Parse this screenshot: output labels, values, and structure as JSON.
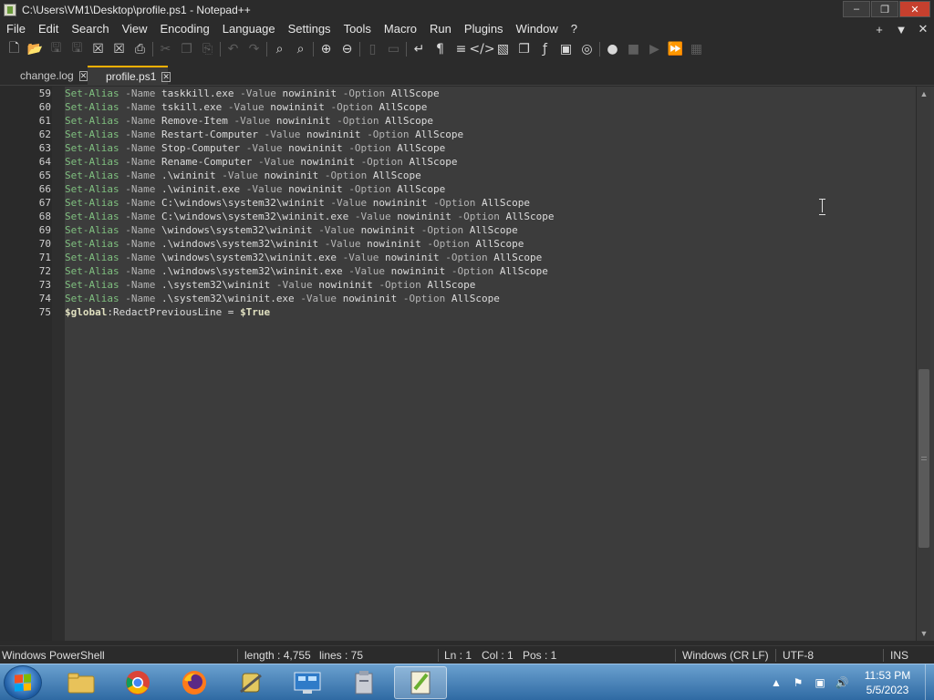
{
  "window": {
    "title": "C:\\Users\\VM1\\Desktop\\profile.ps1 - Notepad++",
    "min": "–",
    "restore": "❐",
    "close": "✕"
  },
  "menu": {
    "items": [
      "File",
      "Edit",
      "Search",
      "View",
      "Encoding",
      "Language",
      "Settings",
      "Tools",
      "Macro",
      "Run",
      "Plugins",
      "Window",
      "?"
    ],
    "right": [
      "+",
      "▼",
      "✕"
    ]
  },
  "tabs": [
    {
      "label": "change.log",
      "active": false
    },
    {
      "label": "profile.ps1",
      "active": true
    }
  ],
  "editor": {
    "lines": [
      {
        "n": "59",
        "name": "taskkill.exe"
      },
      {
        "n": "60",
        "name": "tskill.exe"
      },
      {
        "n": "61",
        "name": "Remove-Item"
      },
      {
        "n": "62",
        "name": "Restart-Computer"
      },
      {
        "n": "63",
        "name": "Stop-Computer"
      },
      {
        "n": "64",
        "name": "Rename-Computer"
      },
      {
        "n": "65",
        "name": ".\\wininit"
      },
      {
        "n": "66",
        "name": ".\\wininit.exe"
      },
      {
        "n": "67",
        "name": "C:\\windows\\system32\\wininit"
      },
      {
        "n": "68",
        "name": "C:\\windows\\system32\\wininit.exe"
      },
      {
        "n": "69",
        "name": "\\windows\\system32\\wininit"
      },
      {
        "n": "70",
        "name": ".\\windows\\system32\\wininit"
      },
      {
        "n": "71",
        "name": "\\windows\\system32\\wininit.exe"
      },
      {
        "n": "72",
        "name": ".\\windows\\system32\\wininit.exe"
      },
      {
        "n": "73",
        "name": ".\\system32\\wininit"
      },
      {
        "n": "74",
        "name": ".\\system32\\wininit.exe"
      }
    ],
    "cmd": "Set-Alias",
    "p_name": "-Name",
    "p_value": "-Value",
    "value": "nowininit",
    "p_option": "-Option",
    "option": "AllScope",
    "last_line": {
      "n": "75",
      "var": "$global",
      "rest": ":RedactPreviousLine = ",
      "val": "$True"
    }
  },
  "status": {
    "language": "Windows PowerShell",
    "length": "length : 4,755",
    "lines": "lines : 75",
    "ln": "Ln : 1",
    "col": "Col : 1",
    "pos": "Pos : 1",
    "eol": "Windows (CR LF)",
    "encoding": "UTF-8",
    "mode": "INS"
  },
  "taskbar": {
    "time": "11:53 PM",
    "date": "5/5/2023"
  },
  "colors": {
    "accent_tab": "#ffb000",
    "code_cmd": "#7fbf7f",
    "close_button": "#c6402e"
  }
}
